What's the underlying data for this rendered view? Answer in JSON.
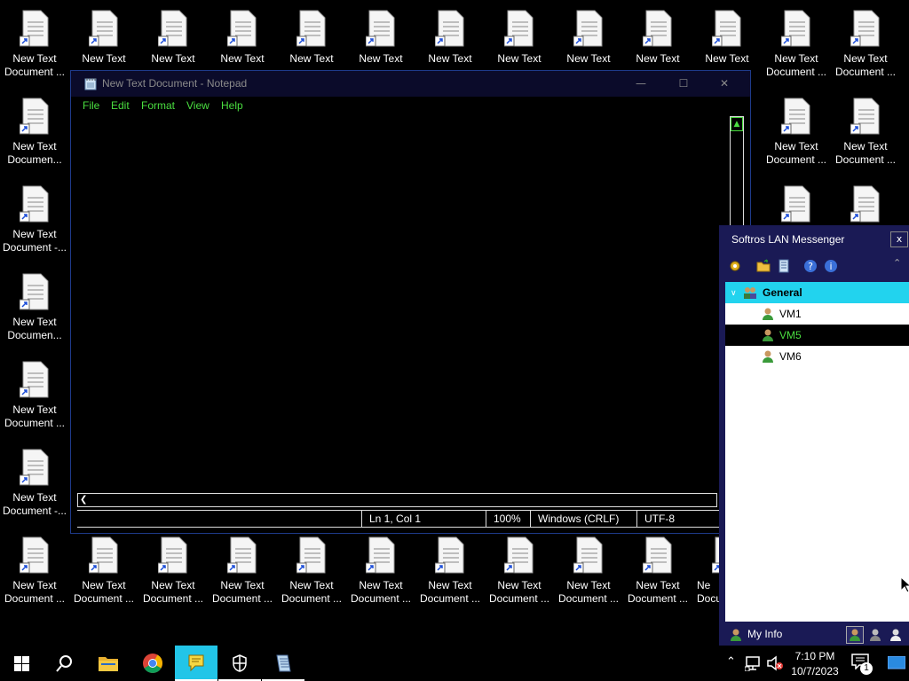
{
  "desktop": {
    "icons": [
      {
        "label1": "New Text",
        "label2": "Document ..."
      },
      {
        "label1": "New Text",
        "label2": "Documen..."
      },
      {
        "label1": "New Text",
        "label2": "Document -..."
      },
      {
        "label1": "New Text",
        "label2": "Documen..."
      },
      {
        "label1": "New Text",
        "label2": "Document ..."
      },
      {
        "label1": "New Text",
        "label2": "Document -..."
      },
      {
        "label1": "New Text",
        "label2": "Document ..."
      }
    ],
    "top_row_label": "New Text",
    "top_row_right_label2": "Document ...",
    "bottom_row_label1": "New Text",
    "bottom_row_label2": "Document ...",
    "bottom_row_partial_label1": "Ne",
    "bottom_row_partial_label2": "Docu"
  },
  "notepad": {
    "title": "New Text Document - Notepad",
    "menu": [
      "File",
      "Edit",
      "Format",
      "View",
      "Help"
    ],
    "status": {
      "position": "Ln 1, Col 1",
      "zoom": "100%",
      "line_ending": "Windows (CRLF)",
      "encoding": "UTF-8"
    }
  },
  "messenger": {
    "title": "Softros LAN Messenger",
    "close": "x",
    "group": "General",
    "contacts": [
      "VM1",
      "VM5",
      "VM6"
    ],
    "footer_label": "My Info"
  },
  "taskbar": {
    "time": "7:10 PM",
    "date": "10/7/2023",
    "notification_count": "1"
  },
  "colors": {
    "menu_green": "#4ade40",
    "selected_group": "#22d3ee",
    "messenger_bg": "#1a1a55"
  }
}
